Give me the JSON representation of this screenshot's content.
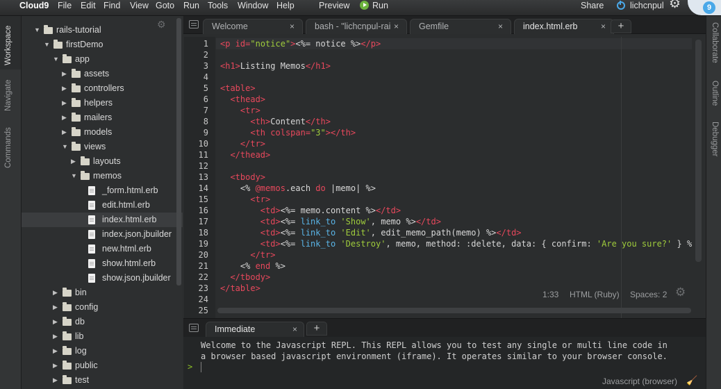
{
  "menubar": {
    "brand": "Cloud9",
    "items": [
      "File",
      "Edit",
      "Find",
      "View",
      "Goto",
      "Run",
      "Tools",
      "Window",
      "Help"
    ],
    "preview_label": "Preview",
    "run_label": "Run",
    "share_label": "Share",
    "username": "lichcnpul",
    "badge_count": "9"
  },
  "left_panels": [
    "Workspace",
    "Navigate",
    "Commands"
  ],
  "right_panels": [
    "Collaborate",
    "Outline",
    "Debugger"
  ],
  "tree": [
    {
      "label": "rails-tutorial",
      "type": "folder",
      "depth": 0,
      "expanded": true
    },
    {
      "label": "firstDemo",
      "type": "folder",
      "depth": 1,
      "expanded": true
    },
    {
      "label": "app",
      "type": "folder",
      "depth": 2,
      "expanded": true
    },
    {
      "label": "assets",
      "type": "folder",
      "depth": 3,
      "expanded": false
    },
    {
      "label": "controllers",
      "type": "folder",
      "depth": 3,
      "expanded": false
    },
    {
      "label": "helpers",
      "type": "folder",
      "depth": 3,
      "expanded": false
    },
    {
      "label": "mailers",
      "type": "folder",
      "depth": 3,
      "expanded": false
    },
    {
      "label": "models",
      "type": "folder",
      "depth": 3,
      "expanded": false
    },
    {
      "label": "views",
      "type": "folder",
      "depth": 3,
      "expanded": true
    },
    {
      "label": "layouts",
      "type": "folder",
      "depth": 4,
      "expanded": false
    },
    {
      "label": "memos",
      "type": "folder",
      "depth": 4,
      "expanded": true
    },
    {
      "label": "_form.html.erb",
      "type": "file",
      "depth": 5
    },
    {
      "label": "edit.html.erb",
      "type": "file",
      "depth": 5
    },
    {
      "label": "index.html.erb",
      "type": "file",
      "depth": 5,
      "selected": true
    },
    {
      "label": "index.json.jbuilder",
      "type": "file",
      "depth": 5
    },
    {
      "label": "new.html.erb",
      "type": "file",
      "depth": 5
    },
    {
      "label": "show.html.erb",
      "type": "file",
      "depth": 5
    },
    {
      "label": "show.json.jbuilder",
      "type": "file",
      "depth": 5
    },
    {
      "label": "bin",
      "type": "folder",
      "depth": 2,
      "expanded": false
    },
    {
      "label": "config",
      "type": "folder",
      "depth": 2,
      "expanded": false
    },
    {
      "label": "db",
      "type": "folder",
      "depth": 2,
      "expanded": false
    },
    {
      "label": "lib",
      "type": "folder",
      "depth": 2,
      "expanded": false
    },
    {
      "label": "log",
      "type": "folder",
      "depth": 2,
      "expanded": false
    },
    {
      "label": "public",
      "type": "folder",
      "depth": 2,
      "expanded": false
    },
    {
      "label": "test",
      "type": "folder",
      "depth": 2,
      "expanded": false
    }
  ],
  "editor_tabs": [
    {
      "label": "Welcome",
      "active": false
    },
    {
      "label": "bash - \"lichcnpul-rails",
      "active": false
    },
    {
      "label": "Gemfile",
      "active": false
    },
    {
      "label": "index.html.erb",
      "active": true
    }
  ],
  "code_lines": [
    [
      [
        "tag",
        "<p "
      ],
      [
        "attr",
        "id="
      ],
      [
        "str",
        "\"notice\""
      ],
      [
        "tag",
        ">"
      ],
      [
        "erb",
        "<%= notice %>"
      ],
      [
        "tag",
        "</p>"
      ]
    ],
    [],
    [
      [
        "tag",
        "<h1>"
      ],
      [
        "erb",
        "Listing Memos"
      ],
      [
        "tag",
        "</h1>"
      ]
    ],
    [],
    [
      [
        "tag",
        "<table>"
      ]
    ],
    [
      [
        "erb",
        "  "
      ],
      [
        "tag",
        "<thead>"
      ]
    ],
    [
      [
        "erb",
        "    "
      ],
      [
        "tag",
        "<tr>"
      ]
    ],
    [
      [
        "erb",
        "      "
      ],
      [
        "tag",
        "<th>"
      ],
      [
        "erb",
        "Content"
      ],
      [
        "tag",
        "</th>"
      ]
    ],
    [
      [
        "erb",
        "      "
      ],
      [
        "tag",
        "<th "
      ],
      [
        "attr",
        "colspan="
      ],
      [
        "str",
        "\"3\""
      ],
      [
        "tag",
        "></th>"
      ]
    ],
    [
      [
        "erb",
        "    "
      ],
      [
        "tag",
        "</tr>"
      ]
    ],
    [
      [
        "erb",
        "  "
      ],
      [
        "tag",
        "</thead>"
      ]
    ],
    [],
    [
      [
        "erb",
        "  "
      ],
      [
        "tag",
        "<tbody>"
      ]
    ],
    [
      [
        "erb",
        "    <% "
      ],
      [
        "ivar",
        "@memos"
      ],
      [
        "erb",
        ".each "
      ],
      [
        "kw",
        "do"
      ],
      [
        "erb",
        " |memo| %>"
      ]
    ],
    [
      [
        "erb",
        "      "
      ],
      [
        "tag",
        "<tr>"
      ]
    ],
    [
      [
        "erb",
        "        "
      ],
      [
        "tag",
        "<td>"
      ],
      [
        "erb",
        "<%= memo.content %>"
      ],
      [
        "tag",
        "</td>"
      ]
    ],
    [
      [
        "erb",
        "        "
      ],
      [
        "tag",
        "<td>"
      ],
      [
        "erb",
        "<%= "
      ],
      [
        "fn",
        "link_to"
      ],
      [
        "erb",
        " "
      ],
      [
        "str",
        "'Show'"
      ],
      [
        "erb",
        ", memo %>"
      ],
      [
        "tag",
        "</td>"
      ]
    ],
    [
      [
        "erb",
        "        "
      ],
      [
        "tag",
        "<td>"
      ],
      [
        "erb",
        "<%= "
      ],
      [
        "fn",
        "link_to"
      ],
      [
        "erb",
        " "
      ],
      [
        "str",
        "'Edit'"
      ],
      [
        "erb",
        ", edit_memo_path(memo) %>"
      ],
      [
        "tag",
        "</td>"
      ]
    ],
    [
      [
        "erb",
        "        "
      ],
      [
        "tag",
        "<td>"
      ],
      [
        "erb",
        "<%= "
      ],
      [
        "fn",
        "link_to"
      ],
      [
        "erb",
        " "
      ],
      [
        "str",
        "'Destroy'"
      ],
      [
        "erb",
        ", memo, method: :delete, data: { confirm: "
      ],
      [
        "str",
        "'Are you sure?'"
      ],
      [
        "erb",
        " } %"
      ]
    ],
    [
      [
        "erb",
        "      "
      ],
      [
        "tag",
        "</tr>"
      ]
    ],
    [
      [
        "erb",
        "    <% "
      ],
      [
        "kw",
        "end"
      ],
      [
        "erb",
        " %>"
      ]
    ],
    [
      [
        "erb",
        "  "
      ],
      [
        "tag",
        "</tbody>"
      ]
    ],
    [
      [
        "tag",
        "</table>"
      ]
    ],
    [],
    []
  ],
  "statusbar": {
    "cursor": "1:33",
    "mode": "HTML (Ruby)",
    "spaces": "Spaces: 2"
  },
  "console": {
    "tab_label": "Immediate",
    "lines": [
      "Welcome to the Javascript REPL. This REPL allows you to test any single or multi line code in",
      "a browser based javascript environment (iframe). It operates similar to your browser console."
    ],
    "prompt": ">",
    "mode": "Javascript (browser)"
  }
}
